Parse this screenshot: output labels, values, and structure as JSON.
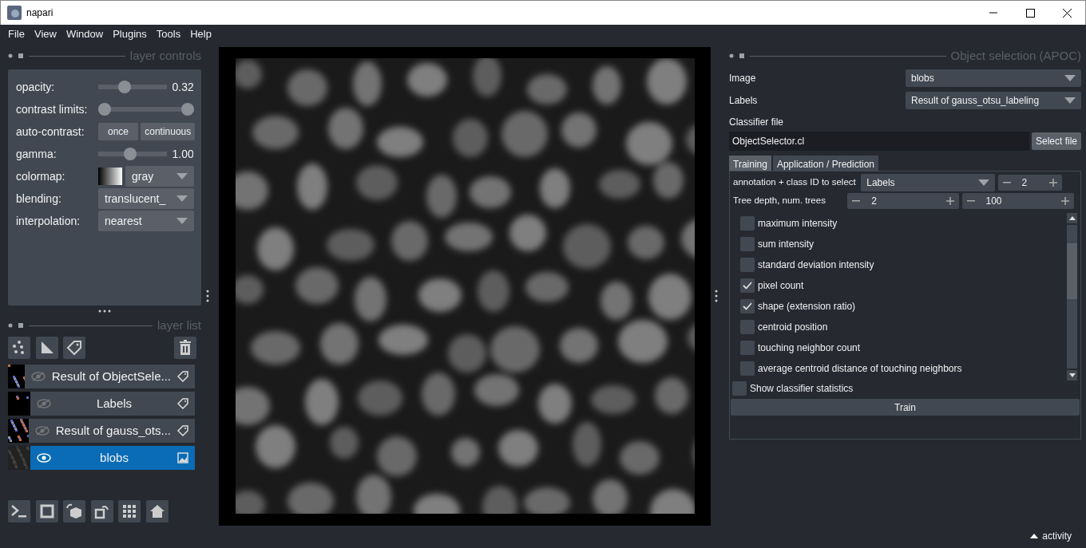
{
  "window": {
    "title": "napari"
  },
  "menu": [
    "File",
    "View",
    "Window",
    "Plugins",
    "Tools",
    "Help"
  ],
  "layer_controls": {
    "title": "layer controls",
    "opacity": {
      "label": "opacity:",
      "level": 0.35,
      "reading": "0.32"
    },
    "contrast_limits": {
      "label": "contrast limits:"
    },
    "auto_contrast": {
      "label": "auto-contrast:",
      "buttons": [
        "once",
        "continuous"
      ]
    },
    "gamma": {
      "label": "gamma:",
      "level": 0.45,
      "reading": "1.00"
    },
    "colormap": {
      "label": "colormap:",
      "value": "gray"
    },
    "blending": {
      "label": "blending:",
      "value": "translucent_"
    },
    "interpolation": {
      "label": "interpolation:",
      "value": "nearest"
    }
  },
  "layer_list": {
    "title": "layer list",
    "layers": [
      {
        "name": "Result of ObjectSele...",
        "kind": "labels",
        "visible": false,
        "selected": false
      },
      {
        "name": "Labels",
        "kind": "labels",
        "visible": false,
        "selected": false
      },
      {
        "name": "Result of gauss_ots...",
        "kind": "labels",
        "visible": false,
        "selected": false
      },
      {
        "name": "blobs",
        "kind": "image",
        "visible": true,
        "selected": true
      }
    ]
  },
  "plugin": {
    "title": "Object selection (APOC)",
    "image": {
      "label": "Image",
      "value": "blobs"
    },
    "labels": {
      "label": "Labels",
      "value": "Result of gauss_otsu_labeling"
    },
    "classifier_file": {
      "label": "Classifier file",
      "value": "ObjectSelector.cl",
      "button": "Select file"
    },
    "tabs": [
      {
        "label": "Training",
        "selected": true
      },
      {
        "label": "Application / Prediction",
        "selected": false
      }
    ],
    "annotation": {
      "label": "annotation + class ID to select",
      "value": "Labels",
      "class_id": "2"
    },
    "tree": {
      "label": "Tree depth, num. trees",
      "depth": "2",
      "trees": "100"
    },
    "features": [
      {
        "label": "maximum intensity",
        "checked": false
      },
      {
        "label": "sum intensity",
        "checked": false
      },
      {
        "label": "standard deviation intensity",
        "checked": false
      },
      {
        "label": "pixel count",
        "checked": true
      },
      {
        "label": "shape (extension ratio)",
        "checked": true
      },
      {
        "label": "centroid position",
        "checked": false
      },
      {
        "label": "touching neighbor count",
        "checked": false
      },
      {
        "label": "average centroid distance of touching neighbors",
        "checked": false
      }
    ],
    "show_statistics": {
      "label": "Show classifier statistics",
      "checked": false
    },
    "train_button": "Train"
  },
  "status_bar": {
    "activity": "activity"
  }
}
